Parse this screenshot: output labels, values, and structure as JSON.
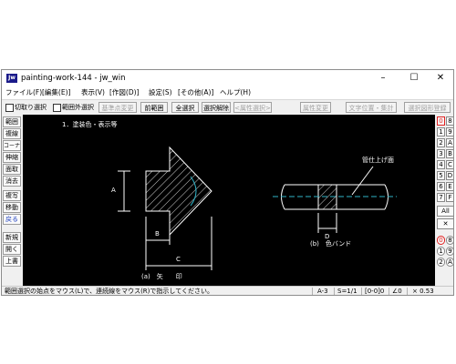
{
  "window": {
    "title": "painting-work-144 - jw_win",
    "icon_label": "Jw",
    "minimize_glyph": "–",
    "maximize_glyph": "☐",
    "close_glyph": "✕"
  },
  "menu": [
    "ファイル(F)",
    "[編集(E)]",
    "表示(V)",
    "[作図(D)]",
    "設定(S)",
    "[その他(A)]",
    "ヘルプ(H)"
  ],
  "toolbar": {
    "checkbox1": "切取り選択",
    "checkbox2": "範囲外選択",
    "btn_kijun": "基準点変更",
    "btn_zenkai": "前範囲",
    "btn_zensentaku": "全選択",
    "btn_kaijo": "選択解除",
    "btn_zokusei": "<属性選択>",
    "btn_zokusei_henko": "属性変更",
    "btn_moji": "文字位置・集計",
    "btn_zukei": "選択図形登録"
  },
  "left_tools": [
    "範囲",
    "複線",
    "コーナー",
    "伸縮",
    "面取",
    "消去",
    "複写",
    "移動",
    "戻る",
    "新規",
    "開く",
    "上書"
  ],
  "right_tools": {
    "row1": [
      "0",
      "8"
    ],
    "rows": [
      [
        "1",
        "9"
      ],
      [
        "2",
        "A"
      ],
      [
        "3",
        "B"
      ],
      [
        "4",
        "C"
      ],
      [
        "5",
        "D"
      ],
      [
        "6",
        "E"
      ],
      [
        "7",
        "F"
      ]
    ],
    "all": "All",
    "swap": "✕",
    "lower1": [
      "0",
      "8"
    ],
    "lower2": [
      "1",
      "9"
    ],
    "lower3": [
      "2",
      "A"
    ]
  },
  "drawing": {
    "heading": "1．塗装色・表示等",
    "label_a": "A",
    "label_b": "B",
    "label_c": "C",
    "label_d": "D",
    "caption_a": "(a)　矢　　印",
    "caption_b": "(b)　色バンド",
    "leader_text": "管仕上げ面"
  },
  "status": {
    "message": "範囲選択の始点をマウス(L)で、連続線をマウス(R)で指示してください。",
    "paper": "A-3",
    "scale": "S=1/1",
    "layer": "[0-0]0",
    "angle": "∠0",
    "zoom": "× 0.53"
  }
}
